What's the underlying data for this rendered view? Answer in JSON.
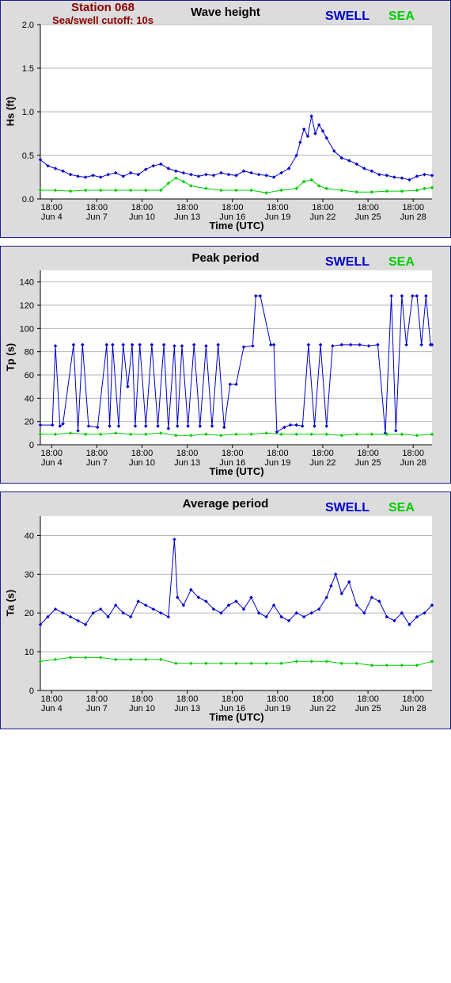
{
  "station": "Station 068",
  "cutoff": "Sea/swell cutoff: 10s",
  "legend": {
    "swell": "SWELL",
    "sea": "SEA",
    "swell_color": "#0000cc",
    "sea_color": "#00cc00"
  },
  "chart_data": [
    {
      "type": "line",
      "title": "Wave height",
      "xlabel": "Time (UTC)",
      "ylabel": "Hs (ft)",
      "ylim": [
        0,
        2.0
      ],
      "yticks": [
        "0.0",
        "0.5",
        "1.0",
        "1.5",
        "2.0"
      ],
      "x_time_labels": [
        "18:00",
        "18:00",
        "18:00",
        "18:00",
        "18:00",
        "18:00",
        "18:00",
        "18:00",
        "18:00"
      ],
      "x_date_labels": [
        "Jun 4",
        "Jun 7",
        "Jun 10",
        "Jun 13",
        "Jun 16",
        "Jun 19",
        "Jun 22",
        "Jun 25",
        "Jun 28"
      ],
      "x_day_range": [
        4,
        30
      ],
      "grid": true,
      "series": [
        {
          "name": "SWELL",
          "x": [
            4,
            4.5,
            5,
            5.5,
            6,
            6.5,
            7,
            7.5,
            8,
            8.5,
            9,
            9.5,
            10,
            10.5,
            11,
            11.5,
            12,
            12.5,
            13,
            13.5,
            14,
            14.5,
            15,
            15.5,
            16,
            16.5,
            17,
            17.5,
            18,
            18.5,
            19,
            19.5,
            20,
            20.5,
            21,
            21.25,
            21.5,
            21.75,
            22,
            22.25,
            22.5,
            22.75,
            23,
            23.5,
            24,
            24.5,
            25,
            25.5,
            26,
            26.5,
            27,
            27.5,
            28,
            28.5,
            29,
            29.5,
            30
          ],
          "y": [
            0.45,
            0.38,
            0.35,
            0.32,
            0.28,
            0.26,
            0.25,
            0.27,
            0.25,
            0.28,
            0.3,
            0.26,
            0.3,
            0.28,
            0.34,
            0.38,
            0.4,
            0.35,
            0.32,
            0.3,
            0.28,
            0.26,
            0.28,
            0.27,
            0.3,
            0.28,
            0.27,
            0.32,
            0.3,
            0.28,
            0.27,
            0.25,
            0.3,
            0.35,
            0.5,
            0.65,
            0.8,
            0.72,
            0.95,
            0.75,
            0.85,
            0.78,
            0.7,
            0.55,
            0.47,
            0.44,
            0.4,
            0.35,
            0.32,
            0.28,
            0.27,
            0.25,
            0.24,
            0.22,
            0.26,
            0.28,
            0.27
          ]
        },
        {
          "name": "SEA",
          "x": [
            4,
            5,
            6,
            7,
            8,
            9,
            10,
            11,
            12,
            12.5,
            13,
            13.5,
            14,
            15,
            16,
            17,
            18,
            19,
            20,
            21,
            21.5,
            22,
            22.5,
            23,
            24,
            25,
            26,
            27,
            28,
            29,
            29.5,
            30
          ],
          "y": [
            0.1,
            0.1,
            0.09,
            0.1,
            0.1,
            0.1,
            0.1,
            0.1,
            0.1,
            0.18,
            0.24,
            0.2,
            0.15,
            0.12,
            0.1,
            0.1,
            0.1,
            0.07,
            0.1,
            0.12,
            0.2,
            0.22,
            0.15,
            0.12,
            0.1,
            0.08,
            0.08,
            0.09,
            0.09,
            0.1,
            0.12,
            0.13
          ]
        }
      ]
    },
    {
      "type": "line",
      "title": "Peak period",
      "xlabel": "Time (UTC)",
      "ylabel": "Tp (s)",
      "ylim": [
        0,
        150
      ],
      "yticks": [
        "0",
        "20",
        "40",
        "60",
        "80",
        "100",
        "120",
        "140"
      ],
      "x_time_labels": [
        "18:00",
        "18:00",
        "18:00",
        "18:00",
        "18:00",
        "18:00",
        "18:00",
        "18:00",
        "18:00"
      ],
      "x_date_labels": [
        "Jun 4",
        "Jun 7",
        "Jun 10",
        "Jun 13",
        "Jun 16",
        "Jun 19",
        "Jun 22",
        "Jun 25",
        "Jun 28"
      ],
      "x_day_range": [
        4,
        30
      ],
      "grid": true,
      "series": [
        {
          "name": "SWELL",
          "x": [
            4,
            4.8,
            5,
            5.3,
            5.5,
            6.2,
            6.5,
            6.8,
            7.2,
            7.8,
            8.4,
            8.6,
            8.8,
            9.2,
            9.5,
            9.8,
            10.1,
            10.3,
            10.6,
            11,
            11.4,
            11.8,
            12.2,
            12.5,
            12.9,
            13.1,
            13.4,
            13.8,
            14.2,
            14.6,
            15,
            15.4,
            15.8,
            16.2,
            16.6,
            17,
            17.5,
            18.1,
            18.3,
            18.6,
            19.3,
            19.5,
            19.7,
            20.2,
            20.6,
            21,
            21.4,
            21.8,
            22.2,
            22.6,
            23,
            23.4,
            24,
            24.6,
            25.2,
            25.8,
            26.4,
            26.9,
            27.3,
            27.6,
            28,
            28.3,
            28.7,
            29,
            29.3,
            29.6,
            29.9,
            30
          ],
          "y": [
            17,
            17,
            85,
            16,
            18,
            86,
            12,
            86,
            16,
            15,
            86,
            16,
            86,
            16,
            86,
            50,
            86,
            16,
            86,
            16,
            86,
            16,
            86,
            14,
            85,
            16,
            85,
            16,
            86,
            16,
            85,
            16,
            86,
            15,
            52,
            52,
            84,
            85,
            128,
            128,
            86,
            86,
            11,
            15,
            17,
            17,
            16,
            86,
            16,
            86,
            16,
            85,
            86,
            86,
            86,
            85,
            86,
            10,
            128,
            12,
            128,
            86,
            128,
            128,
            86,
            128,
            86,
            86
          ]
        },
        {
          "name": "SEA",
          "x": [
            4,
            5,
            6,
            7,
            8,
            9,
            10,
            11,
            12,
            13,
            14,
            15,
            16,
            17,
            18,
            19,
            20,
            21,
            22,
            23,
            24,
            25,
            26,
            27,
            28,
            29,
            30
          ],
          "y": [
            9,
            9,
            10,
            9,
            9,
            10,
            9,
            9,
            10,
            8,
            8,
            9,
            8,
            9,
            9,
            10,
            9,
            9,
            9,
            9,
            8,
            9,
            9,
            9,
            9,
            8,
            9
          ]
        }
      ]
    },
    {
      "type": "line",
      "title": "Average period",
      "xlabel": "Time (UTC)",
      "ylabel": "Ta (s)",
      "ylim": [
        0,
        45
      ],
      "yticks": [
        "0",
        "10",
        "20",
        "30",
        "40"
      ],
      "x_time_labels": [
        "18:00",
        "18:00",
        "18:00",
        "18:00",
        "18:00",
        "18:00",
        "18:00",
        "18:00",
        "18:00"
      ],
      "x_date_labels": [
        "Jun 4",
        "Jun 7",
        "Jun 10",
        "Jun 13",
        "Jun 16",
        "Jun 19",
        "Jun 22",
        "Jun 25",
        "Jun 28"
      ],
      "x_day_range": [
        4,
        30
      ],
      "grid": true,
      "series": [
        {
          "name": "SWELL",
          "x": [
            4,
            4.5,
            5,
            5.5,
            6,
            6.5,
            7,
            7.5,
            8,
            8.5,
            9,
            9.5,
            10,
            10.5,
            11,
            11.5,
            12,
            12.5,
            12.9,
            13.1,
            13.5,
            14,
            14.5,
            15,
            15.5,
            16,
            16.5,
            17,
            17.5,
            18,
            18.5,
            19,
            19.5,
            20,
            20.5,
            21,
            21.5,
            22,
            22.5,
            23,
            23.3,
            23.6,
            24,
            24.5,
            25,
            25.5,
            26,
            26.5,
            27,
            27.5,
            28,
            28.5,
            29,
            29.5,
            30
          ],
          "y": [
            17,
            19,
            21,
            20,
            19,
            18,
            17,
            20,
            21,
            19,
            22,
            20,
            19,
            23,
            22,
            21,
            20,
            19,
            39,
            24,
            22,
            26,
            24,
            23,
            21,
            20,
            22,
            23,
            21,
            24,
            20,
            19,
            22,
            19,
            18,
            20,
            19,
            20,
            21,
            24,
            27,
            30,
            25,
            28,
            22,
            20,
            24,
            23,
            19,
            18,
            20,
            17,
            19,
            20,
            22
          ]
        },
        {
          "name": "SEA",
          "x": [
            4,
            5,
            6,
            7,
            8,
            9,
            10,
            11,
            12,
            13,
            14,
            15,
            16,
            17,
            18,
            19,
            20,
            21,
            22,
            23,
            24,
            25,
            26,
            27,
            28,
            29,
            30
          ],
          "y": [
            7.5,
            8,
            8.5,
            8.5,
            8.5,
            8,
            8,
            8,
            8,
            7,
            7,
            7,
            7,
            7,
            7,
            7,
            7,
            7.5,
            7.5,
            7.5,
            7,
            7,
            6.5,
            6.5,
            6.5,
            6.5,
            7.5
          ]
        }
      ]
    }
  ]
}
